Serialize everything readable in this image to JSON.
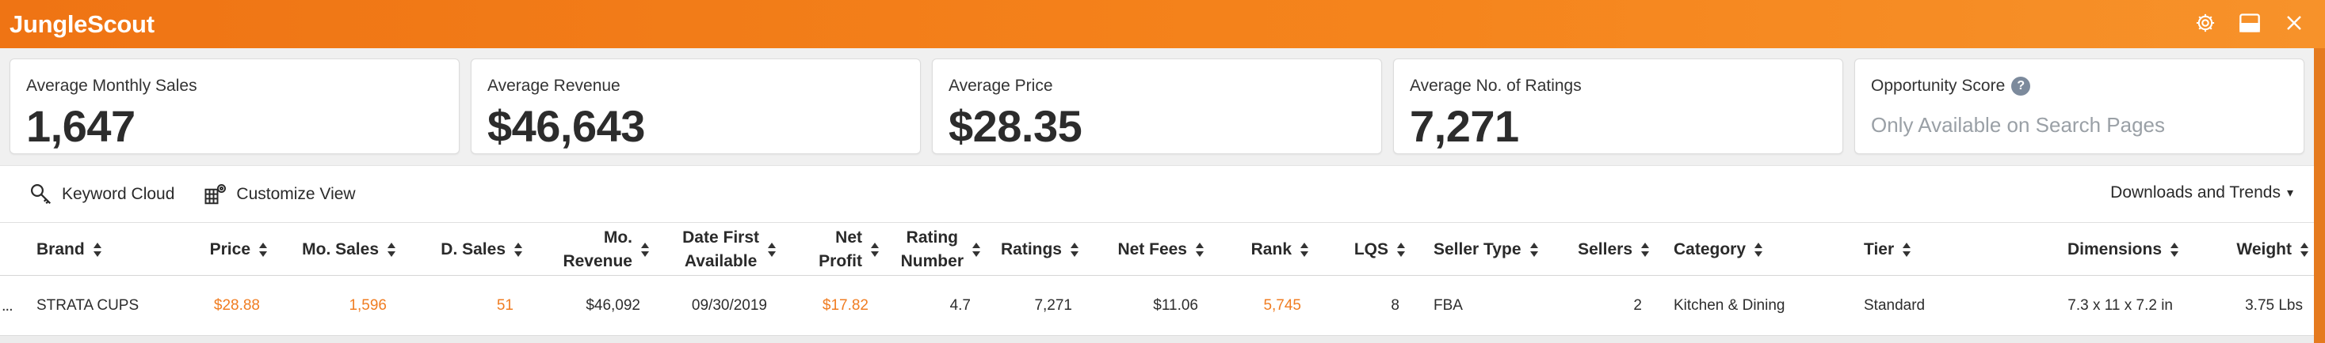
{
  "app": {
    "title": "JungleScout",
    "header_icons": [
      "gear-icon",
      "minimize-window-icon",
      "close-icon"
    ]
  },
  "stats": [
    {
      "label": "Average Monthly Sales",
      "value": "1,647"
    },
    {
      "label": "Average Revenue",
      "value": "$46,643"
    },
    {
      "label": "Average Price",
      "value": "$28.35"
    },
    {
      "label": "Average No. of Ratings",
      "value": "7,271"
    }
  ],
  "opportunity": {
    "label": "Opportunity Score",
    "help": "?",
    "value": "Only Available on Search Pages"
  },
  "toolbar": {
    "keyword_cloud": "Keyword Cloud",
    "customize_view": "Customize View",
    "downloads": "Downloads and Trends",
    "downloads_caret": "▾"
  },
  "table": {
    "columns": {
      "brand": "Brand",
      "price": "Price",
      "mo_sales": "Mo. Sales",
      "d_sales": "D. Sales",
      "mo_revenue_1": "Mo.",
      "mo_revenue_2": "Revenue",
      "date_first_1": "Date First",
      "date_first_2": "Available",
      "net_profit_1": "Net",
      "net_profit_2": "Profit",
      "rating_number_1": "Rating",
      "rating_number_2": "Number",
      "ratings": "Ratings",
      "net_fees": "Net Fees",
      "rank": "Rank",
      "lqs": "LQS",
      "seller_type": "Seller Type",
      "sellers": "Sellers",
      "category": "Category",
      "tier": "Tier",
      "dimensions": "Dimensions",
      "weight": "Weight"
    },
    "rows": [
      {
        "more": "...",
        "brand": "STRATA CUPS",
        "price": "$28.88",
        "mo_sales": "1,596",
        "d_sales": "51",
        "mo_revenue": "$46,092",
        "date_first": "09/30/2019",
        "net_profit": "$17.82",
        "rating_number": "4.7",
        "ratings": "7,271",
        "net_fees": "$11.06",
        "rank": "5,745",
        "lqs": "8",
        "seller_type": "FBA",
        "sellers": "2",
        "category": "Kitchen & Dining",
        "tier": "Standard",
        "dimensions": "7.3 x 11 x 7.2 in",
        "weight": "3.75 Lbs"
      }
    ]
  },
  "colors": {
    "brand_orange": "#f07d22",
    "header_gradient_start": "#ef7414",
    "header_gradient_end": "#f7922a",
    "muted_text": "#9aa0a6"
  }
}
